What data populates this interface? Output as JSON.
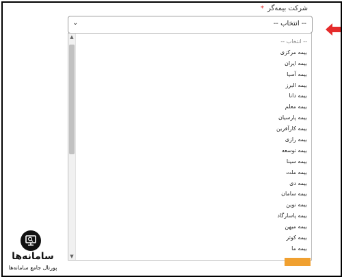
{
  "field": {
    "label": "شرکت بیمه‌گر",
    "required_mark": "*",
    "selected_value": "-- انتخاب --"
  },
  "dropdown": {
    "options": [
      "-- انتخاب --",
      "بیمه مرکزی",
      "بیمه ایران",
      "بیمه آسیا",
      "بیمه البرز",
      "بیمه دانا",
      "بیمه معلم",
      "بیمه پارسیان",
      "بیمه کارآفرین",
      "بیمه رازی",
      "بیمه توسعه",
      "بیمه سینا",
      "بیمه ملت",
      "بیمه دی",
      "بیمه سامان",
      "بیمه نوین",
      "بیمه پاسارگاد",
      "بیمه میهن",
      "بیمه کوثر",
      "بیمه ما"
    ]
  },
  "watermark": {
    "brand": "سامانه‌ها",
    "tagline": "پورتال جامع سامانه‌ها"
  },
  "colors": {
    "arrow": "#e52b2b",
    "required": "#e03030",
    "button": "#f0a030"
  }
}
